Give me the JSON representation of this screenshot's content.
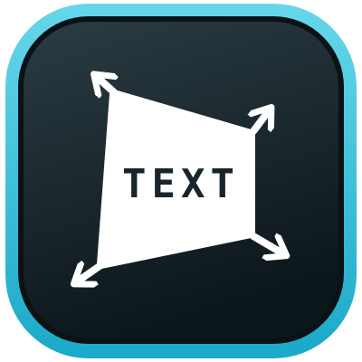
{
  "icon": {
    "text": "TEXT",
    "semantic": "text-transform-icon",
    "colors": {
      "outer_ring_light": "#67d7ea",
      "outer_ring_dark": "#1aa9c9",
      "inner_bg_light": "#2b3c43",
      "inner_bg_dark": "#0c171b",
      "inner_border": "#0a1215",
      "shape_fill": "#ffffff",
      "text_color": "#18262b",
      "arrow_color": "#ffffff"
    }
  }
}
